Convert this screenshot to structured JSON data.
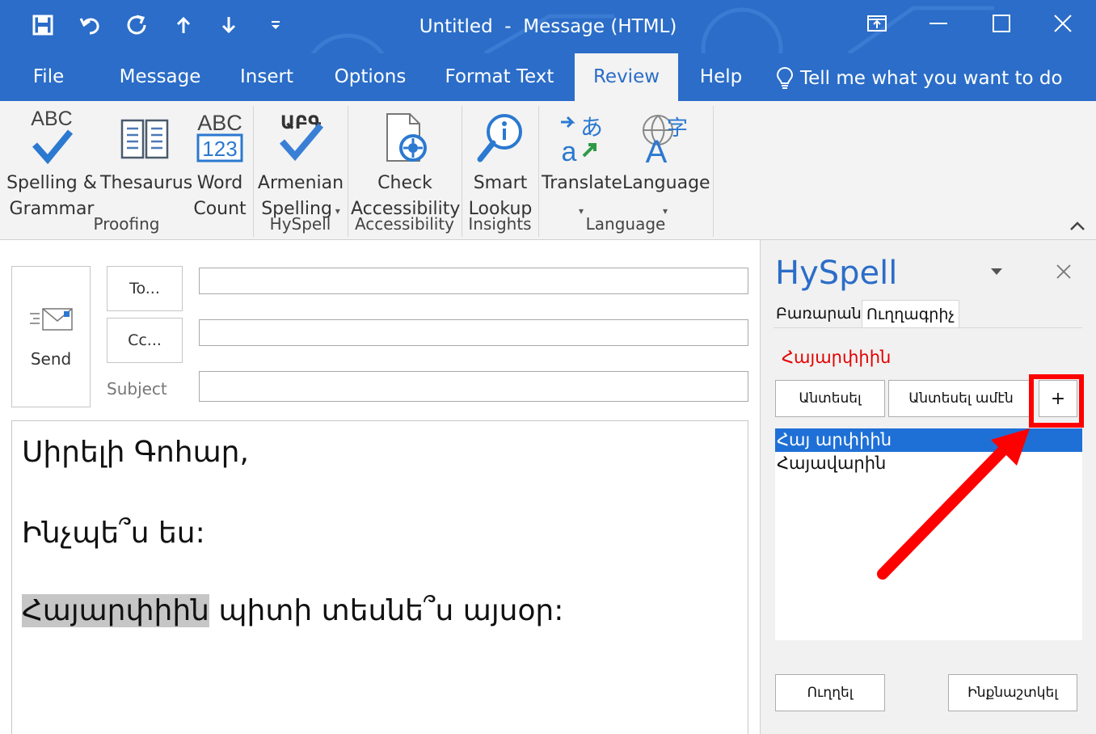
{
  "window": {
    "title": "Untitled  -  Message (HTML)"
  },
  "tabs": [
    {
      "label": "File"
    },
    {
      "label": "Message"
    },
    {
      "label": "Insert"
    },
    {
      "label": "Options"
    },
    {
      "label": "Format Text"
    },
    {
      "label": "Review",
      "active": true
    },
    {
      "label": "Help"
    }
  ],
  "tell_me": "Tell me what you want to do",
  "ribbon": {
    "buttons": {
      "spelling": "Spelling &\nGrammar",
      "thesaurus": "Thesaurus",
      "word_count": "Word\nCount",
      "armenian_spelling": "Armenian\nSpelling",
      "check_accessibility": "Check\nAccessibility",
      "smart_lookup": "Smart\nLookup",
      "translate": "Translate",
      "language": "Language"
    },
    "icon_text": {
      "abc": "ABC",
      "abc123_top": "ABC",
      "abc123_bottom": "123",
      "armenian_abc": "ԱԲԳ"
    },
    "groups": {
      "proofing": "Proofing",
      "hyspell": "HySpell",
      "accessibility": "Accessibility",
      "insights": "Insights",
      "language": "Language"
    }
  },
  "compose": {
    "send": "Send",
    "to": "To...",
    "cc": "Cc...",
    "subject": "Subject",
    "to_value": "",
    "cc_value": "",
    "subject_value": "",
    "body": {
      "line1": "Սիրելի Գոհար,",
      "line2": "Ինչպե՞ս ես:",
      "line3_highlight": "Հայարփիին",
      "line3_rest": " պիտի տեսնե՞ս այսօր:"
    }
  },
  "pane": {
    "title": "HySpell",
    "tabs": [
      "Բառարան",
      "Ուղղագրիչ"
    ],
    "misspelled_word": "Հայարփիին",
    "buttons": {
      "ignore": "Անտեսել",
      "ignore_all": "Անտեսել ամէն",
      "add": "+",
      "correct": "Ուղղել",
      "autocorrect": "Ինքնաշտկել"
    },
    "suggestions": [
      "Հայ արփիին",
      "Հայավարին"
    ]
  },
  "colors": {
    "accent": "#2b6dc8",
    "misspelled": "#e20000",
    "annotation": "#ff0000",
    "selection": "#1e70d6"
  }
}
